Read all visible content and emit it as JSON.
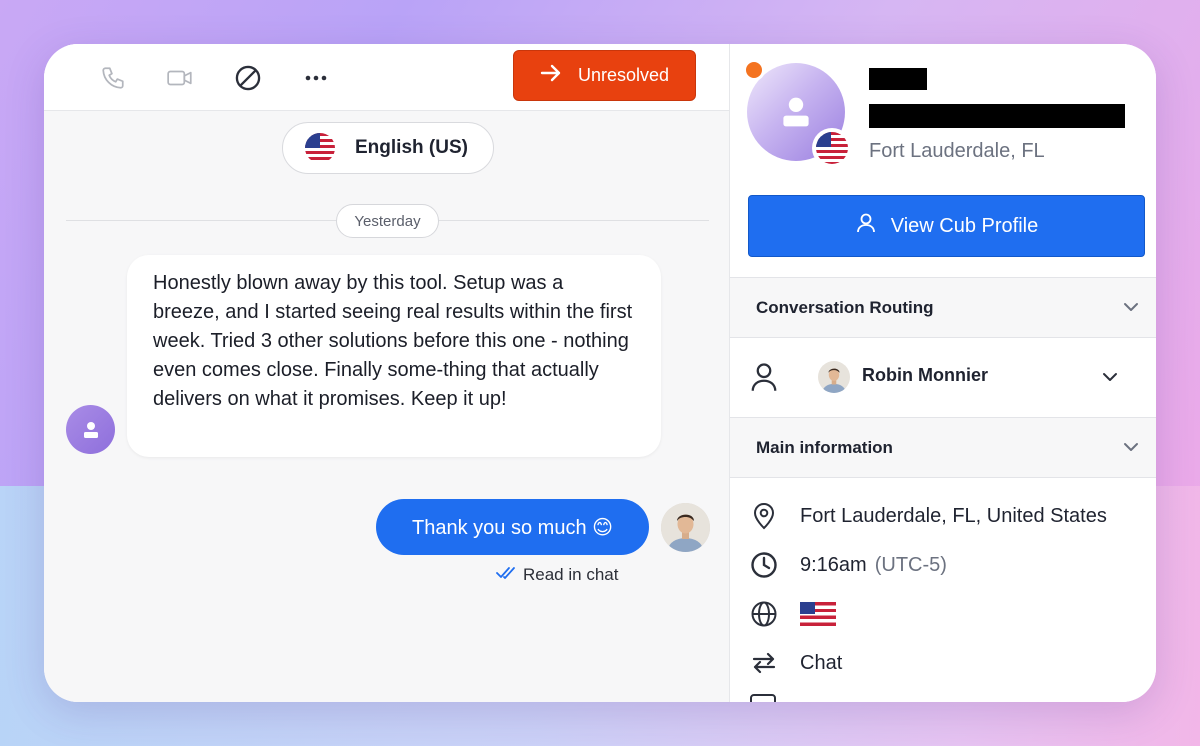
{
  "toolbar": {
    "status_button_label": "Unresolved",
    "icons": [
      "phone-icon",
      "video-icon",
      "block-icon",
      "more-icon"
    ]
  },
  "chat": {
    "language": "English (US)",
    "day_separator": "Yesterday",
    "incoming_message": "Honestly blown away by this tool. Setup was a breeze, and I started seeing real results within the first week. Tried 3 other solutions before this one - nothing even comes close. Finally some-thing that actually delivers on what it promises. Keep it up!",
    "outgoing_message": "Thank you so much 😊",
    "read_status": "Read in chat"
  },
  "profile": {
    "location": "Fort Lauderdale, FL",
    "view_profile_label": "View Cub Profile"
  },
  "sidebar": {
    "routing_header": "Conversation Routing",
    "assignee_name": "Robin Monnier",
    "main_info_header": "Main information",
    "full_location": "Fort Lauderdale, FL, United States",
    "local_time": "9:16am",
    "timezone": "(UTC-5)",
    "channel": "Chat"
  },
  "colors": {
    "accent_blue": "#1f6ef0",
    "unresolved_orange": "#e8410f",
    "online_dot": "#f47320"
  }
}
